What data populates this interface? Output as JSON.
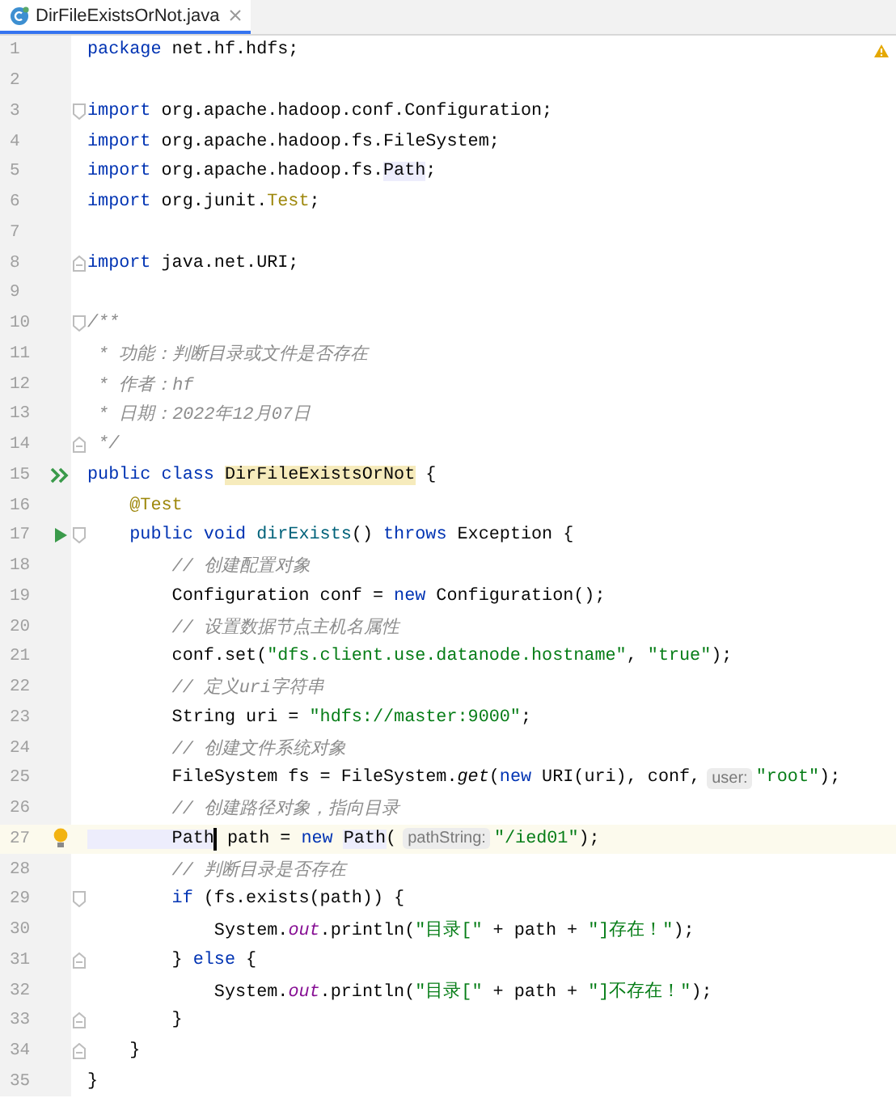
{
  "tabs": [
    {
      "label": "DirFileExistsOrNot.java",
      "selected": true
    }
  ],
  "lines": [
    {
      "number": "1",
      "current": false,
      "segments": [
        {
          "kind": "code",
          "tokens": [
            {
              "kind": "kw",
              "text": "package"
            },
            {
              "kind": "plain",
              "text": " net.hf.hdfs;"
            }
          ]
        }
      ]
    },
    {
      "number": "2",
      "current": false
    },
    {
      "number": "3",
      "current": false,
      "fold": {
        "kind": "start"
      },
      "segments": [
        {
          "kind": "code",
          "tokens": [
            {
              "kind": "kw",
              "text": "import"
            },
            {
              "kind": "plain",
              "text": " org.apache.hadoop.conf.Configuration;"
            }
          ]
        }
      ]
    },
    {
      "number": "4",
      "current": false,
      "segments": [
        {
          "kind": "code",
          "tokens": [
            {
              "kind": "kw",
              "text": "import"
            },
            {
              "kind": "plain",
              "text": " org.apache.hadoop.fs.FileSystem;"
            }
          ]
        }
      ]
    },
    {
      "number": "5",
      "current": false,
      "segments": [
        {
          "kind": "code",
          "tokens": [
            {
              "kind": "kw",
              "text": "import"
            },
            {
              "kind": "plain",
              "text": " org.apache.hadoop.fs."
            },
            {
              "kind": "usage",
              "text": "Path"
            },
            {
              "kind": "plain",
              "text": ";"
            }
          ]
        }
      ]
    },
    {
      "number": "6",
      "current": false,
      "segments": [
        {
          "kind": "code",
          "tokens": [
            {
              "kind": "kw",
              "text": "import"
            },
            {
              "kind": "plain",
              "text": " org.junit."
            },
            {
              "kind": "anno",
              "text": "Test"
            },
            {
              "kind": "plain",
              "text": ";"
            }
          ]
        }
      ]
    },
    {
      "number": "7",
      "current": false
    },
    {
      "number": "8",
      "current": false,
      "fold": {
        "kind": "end"
      },
      "segments": [
        {
          "kind": "code",
          "tokens": [
            {
              "kind": "kw",
              "text": "import"
            },
            {
              "kind": "plain",
              "text": " java.net.URI;"
            }
          ]
        }
      ]
    },
    {
      "number": "9",
      "current": false
    },
    {
      "number": "10",
      "current": false,
      "fold": {
        "kind": "start"
      },
      "segments": [
        {
          "kind": "code",
          "tokens": [
            {
              "kind": "doc",
              "text": "/**"
            }
          ]
        }
      ]
    },
    {
      "number": "11",
      "current": false,
      "segments": [
        {
          "kind": "code",
          "tokens": [
            {
              "kind": "doc",
              "text": " * 功能：判断目录或文件是否存在"
            }
          ]
        }
      ]
    },
    {
      "number": "12",
      "current": false,
      "segments": [
        {
          "kind": "code",
          "tokens": [
            {
              "kind": "doc",
              "text": " * 作者：hf"
            }
          ]
        }
      ]
    },
    {
      "number": "13",
      "current": false,
      "segments": [
        {
          "kind": "code",
          "tokens": [
            {
              "kind": "doc",
              "text": " * 日期：2022年12月07日"
            }
          ]
        }
      ]
    },
    {
      "number": "14",
      "current": false,
      "fold": {
        "kind": "end"
      },
      "segments": [
        {
          "kind": "code",
          "tokens": [
            {
              "kind": "doc",
              "text": " */"
            }
          ]
        }
      ]
    },
    {
      "number": "15",
      "current": false,
      "gutter_icon": {
        "kind": "run-all"
      },
      "segments": [
        {
          "kind": "code",
          "tokens": [
            {
              "kind": "kw",
              "text": "public class "
            },
            {
              "kind": "decl",
              "text": "DirFileExistsOrNot"
            },
            {
              "kind": "plain",
              "text": " {"
            }
          ]
        }
      ]
    },
    {
      "number": "16",
      "current": false,
      "segments": [
        {
          "kind": "code",
          "tokens": [
            {
              "kind": "anno",
              "text": "    @Test"
            }
          ]
        }
      ]
    },
    {
      "number": "17",
      "current": false,
      "gutter_icon": {
        "kind": "run"
      },
      "fold": {
        "kind": "start"
      },
      "segments": [
        {
          "kind": "code",
          "tokens": [
            {
              "kind": "kw",
              "text": "    public void "
            },
            {
              "kind": "method",
              "text": "dirExists"
            },
            {
              "kind": "plain",
              "text": "() "
            },
            {
              "kind": "kw",
              "text": "throws"
            },
            {
              "kind": "plain",
              "text": " Exception {"
            }
          ]
        }
      ]
    },
    {
      "number": "18",
      "current": false,
      "segments": [
        {
          "kind": "code",
          "tokens": [
            {
              "kind": "comment",
              "text": "        // 创建配置对象"
            }
          ]
        }
      ]
    },
    {
      "number": "19",
      "current": false,
      "segments": [
        {
          "kind": "code",
          "tokens": [
            {
              "kind": "plain",
              "text": "        Configuration conf = "
            },
            {
              "kind": "kw",
              "text": "new"
            },
            {
              "kind": "plain",
              "text": " Configuration();"
            }
          ]
        }
      ]
    },
    {
      "number": "20",
      "current": false,
      "segments": [
        {
          "kind": "code",
          "tokens": [
            {
              "kind": "comment",
              "text": "        // 设置数据节点主机名属性"
            }
          ]
        }
      ]
    },
    {
      "number": "21",
      "current": false,
      "segments": [
        {
          "kind": "code",
          "tokens": [
            {
              "kind": "plain",
              "text": "        conf.set("
            },
            {
              "kind": "str",
              "text": "\"dfs.client.use.datanode.hostname\""
            },
            {
              "kind": "plain",
              "text": ", "
            },
            {
              "kind": "str",
              "text": "\"true\""
            },
            {
              "kind": "plain",
              "text": ");"
            }
          ]
        }
      ]
    },
    {
      "number": "22",
      "current": false,
      "segments": [
        {
          "kind": "code",
          "tokens": [
            {
              "kind": "comment",
              "text": "        // 定义uri字符串"
            }
          ]
        }
      ]
    },
    {
      "number": "23",
      "current": false,
      "segments": [
        {
          "kind": "code",
          "tokens": [
            {
              "kind": "plain",
              "text": "        String uri = "
            },
            {
              "kind": "str",
              "text": "\"hdfs://master:9000\""
            },
            {
              "kind": "plain",
              "text": ";"
            }
          ]
        }
      ]
    },
    {
      "number": "24",
      "current": false,
      "segments": [
        {
          "kind": "code",
          "tokens": [
            {
              "kind": "comment",
              "text": "        // 创建文件系统对象"
            }
          ]
        }
      ]
    },
    {
      "number": "25",
      "current": false,
      "segments": [
        {
          "kind": "code",
          "tokens": [
            {
              "kind": "plain",
              "text": "        FileSystem fs = FileSystem."
            },
            {
              "kind": "italic",
              "text": "get"
            },
            {
              "kind": "plain",
              "text": "("
            },
            {
              "kind": "kw",
              "text": "new"
            },
            {
              "kind": "plain",
              "text": " URI(uri), conf,"
            }
          ]
        },
        {
          "kind": "hint",
          "text": "user:"
        },
        {
          "kind": "code",
          "tokens": [
            {
              "kind": "str",
              "text": "\"root\""
            },
            {
              "kind": "plain",
              "text": ");"
            }
          ]
        }
      ]
    },
    {
      "number": "26",
      "current": false,
      "segments": [
        {
          "kind": "code",
          "tokens": [
            {
              "kind": "comment",
              "text": "        // 创建路径对象，指向目录"
            }
          ]
        }
      ]
    },
    {
      "number": "27",
      "current": true,
      "gutter_icon": {
        "kind": "bulb"
      },
      "segments": [
        {
          "kind": "code",
          "tokens": [
            {
              "kind": "usage",
              "text": "        Path"
            }
          ]
        },
        {
          "kind": "caret"
        },
        {
          "kind": "code",
          "tokens": [
            {
              "kind": "plain",
              "text": " path = "
            },
            {
              "kind": "kw",
              "text": "new "
            },
            {
              "kind": "usage",
              "text": "Path"
            },
            {
              "kind": "plain",
              "text": "("
            }
          ]
        },
        {
          "kind": "hint",
          "text": "pathString:"
        },
        {
          "kind": "code",
          "tokens": [
            {
              "kind": "str",
              "text": "\"/ied01\""
            },
            {
              "kind": "plain",
              "text": ");"
            }
          ]
        }
      ]
    },
    {
      "number": "28",
      "current": false,
      "segments": [
        {
          "kind": "code",
          "tokens": [
            {
              "kind": "comment",
              "text": "        // 判断目录是否存在"
            }
          ]
        }
      ]
    },
    {
      "number": "29",
      "current": false,
      "fold": {
        "kind": "start"
      },
      "segments": [
        {
          "kind": "code",
          "tokens": [
            {
              "kind": "kw",
              "text": "        if"
            },
            {
              "kind": "plain",
              "text": " (fs.exists(path)) {"
            }
          ]
        }
      ]
    },
    {
      "number": "30",
      "current": false,
      "segments": [
        {
          "kind": "code",
          "tokens": [
            {
              "kind": "plain",
              "text": "            System."
            },
            {
              "kind": "field",
              "text": "out"
            },
            {
              "kind": "plain",
              "text": ".println("
            },
            {
              "kind": "str",
              "text": "\"目录[\""
            },
            {
              "kind": "plain",
              "text": " + path + "
            },
            {
              "kind": "str",
              "text": "\"]存在！\""
            },
            {
              "kind": "plain",
              "text": ");"
            }
          ]
        }
      ]
    },
    {
      "number": "31",
      "current": false,
      "fold": {
        "kind": "end"
      },
      "segments": [
        {
          "kind": "code",
          "tokens": [
            {
              "kind": "plain",
              "text": "        } "
            },
            {
              "kind": "kw",
              "text": "else"
            },
            {
              "kind": "plain",
              "text": " {"
            }
          ]
        }
      ]
    },
    {
      "number": "32",
      "current": false,
      "segments": [
        {
          "kind": "code",
          "tokens": [
            {
              "kind": "plain",
              "text": "            System."
            },
            {
              "kind": "field",
              "text": "out"
            },
            {
              "kind": "plain",
              "text": ".println("
            },
            {
              "kind": "str",
              "text": "\"目录[\""
            },
            {
              "kind": "plain",
              "text": " + path + "
            },
            {
              "kind": "str",
              "text": "\"]不存在！\""
            },
            {
              "kind": "plain",
              "text": ");"
            }
          ]
        }
      ]
    },
    {
      "number": "33",
      "current": false,
      "fold": {
        "kind": "end"
      },
      "segments": [
        {
          "kind": "code",
          "tokens": [
            {
              "kind": "plain",
              "text": "        }"
            }
          ]
        }
      ]
    },
    {
      "number": "34",
      "current": false,
      "fold": {
        "kind": "end"
      },
      "segments": [
        {
          "kind": "code",
          "tokens": [
            {
              "kind": "plain",
              "text": "    }"
            }
          ]
        }
      ]
    },
    {
      "number": "35",
      "current": false,
      "segments": [
        {
          "kind": "code",
          "tokens": [
            {
              "kind": "plain",
              "text": "}"
            }
          ]
        }
      ]
    }
  ]
}
